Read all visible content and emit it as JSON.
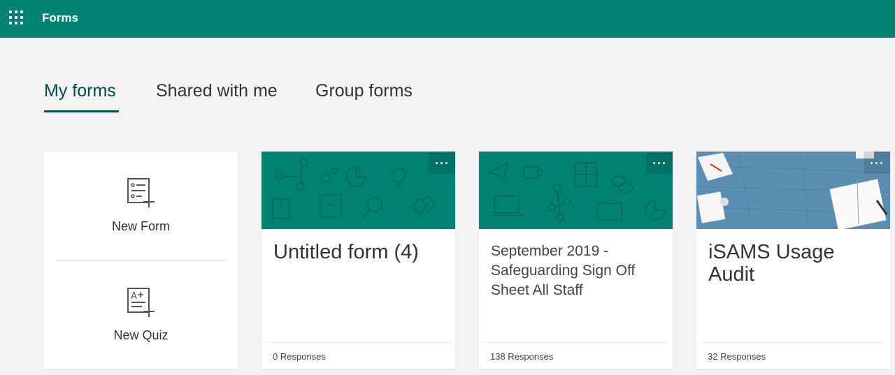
{
  "header": {
    "app_title": "Forms"
  },
  "tabs": [
    {
      "label": "My forms",
      "active": true
    },
    {
      "label": "Shared with me",
      "active": false
    },
    {
      "label": "Group forms",
      "active": false
    }
  ],
  "new_actions": {
    "new_form_label": "New Form",
    "new_quiz_label": "New Quiz"
  },
  "cards": [
    {
      "title": "Untitled form (4)",
      "responses": "0 Responses",
      "theme_color": "#008272"
    },
    {
      "title": "September 2019 - Safeguarding Sign Off Sheet All Staff",
      "responses": "138 Responses",
      "theme_color": "#008272"
    },
    {
      "title": "iSAMS Usage Audit",
      "responses": "32 Responses",
      "theme_color": "#5a8fb3"
    }
  ],
  "colors": {
    "brand": "#008272",
    "tab_active": "#004b50",
    "page_bg": "#f3f3f3"
  }
}
